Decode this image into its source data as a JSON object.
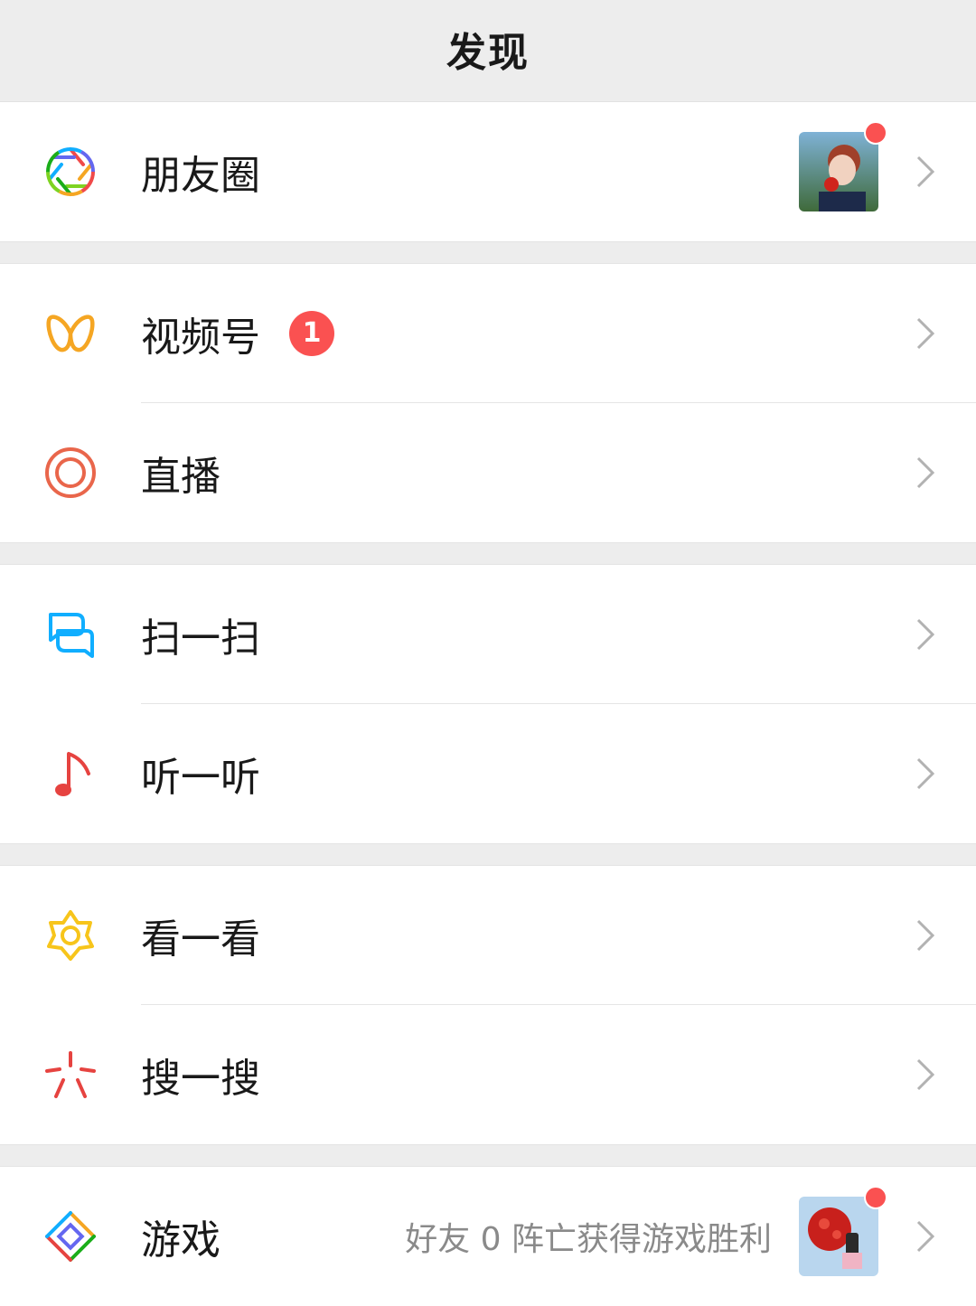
{
  "header": {
    "title": "发现"
  },
  "items": {
    "moments": {
      "label": "朋友圈",
      "icon": "moments-aperture-icon",
      "has_red_dot": true
    },
    "channels": {
      "label": "视频号",
      "icon": "channels-icon",
      "badge": "1"
    },
    "live": {
      "label": "直播",
      "icon": "live-icon"
    },
    "scan": {
      "label": "扫一扫",
      "icon": "scan-icon"
    },
    "listen": {
      "label": "听一听",
      "icon": "music-note-icon"
    },
    "top_stories": {
      "label": "看一看",
      "icon": "top-stories-icon"
    },
    "search": {
      "label": "搜一搜",
      "icon": "search-sparkle-icon"
    },
    "games": {
      "label": "游戏",
      "icon": "games-icon",
      "description": "好友 0 阵亡获得游戏胜利",
      "has_red_dot": true
    }
  },
  "colors": {
    "background": "#ededed",
    "badge_red": "#fa5151",
    "chevron": "#b2b2b2"
  }
}
